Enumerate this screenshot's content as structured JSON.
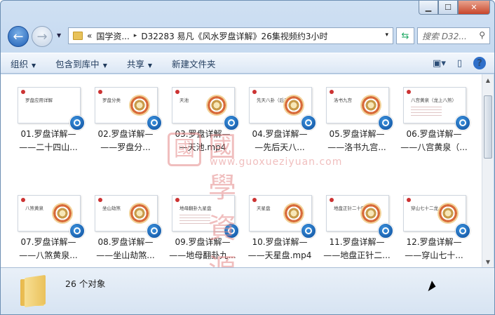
{
  "window_controls": {
    "minimize": "▁",
    "maximize": "☐",
    "close": "✕"
  },
  "address": {
    "history": "«",
    "crumbs": [
      "国学资...",
      "D32283 易凡《风水罗盘详解》26集视频约3小时"
    ],
    "separator": "▸",
    "dropdown": "▾"
  },
  "search": {
    "placeholder": "搜索 D32...",
    "icon": "search-icon"
  },
  "toolbar": {
    "organize": "组织",
    "include_library": "包含到库中",
    "share": "共享",
    "new_folder": "新建文件夹",
    "dropdown_glyph": "▼"
  },
  "items": [
    {
      "line1": "01.罗盘详解—",
      "line2": "——二十四山...",
      "thumb_title": "罗盘应用详解",
      "thumb": "plain"
    },
    {
      "line1": "02.罗盘详解—",
      "line2": "——罗盘分...",
      "thumb_title": "罗盘分类",
      "thumb": "wheel"
    },
    {
      "line1": "03.罗盘详解—",
      "line2": "—天池.mp4",
      "thumb_title": "天池",
      "thumb": "wheel"
    },
    {
      "line1": "04.罗盘详解—",
      "line2": "—先后天八...",
      "thumb_title": "先天八卦（后天）",
      "thumb": "wheel"
    },
    {
      "line1": "05.罗盘详解—",
      "line2": "——洛书九宫...",
      "thumb_title": "洛书九宫",
      "thumb": "wheel"
    },
    {
      "line1": "06.罗盘详解—",
      "line2": "——八宫黄泉（...",
      "thumb_title": "八宫黄泉（龙上八煞）",
      "thumb": "lines"
    },
    {
      "line1": "07.罗盘详解—",
      "line2": "——八煞黄泉...",
      "thumb_title": "八煞黄泉",
      "thumb": "wheel"
    },
    {
      "line1": "08.罗盘详解—",
      "line2": "——坐山劫煞...",
      "thumb_title": "坐山劫煞",
      "thumb": "wheel"
    },
    {
      "line1": "09.罗盘详解—",
      "line2": "——地母翻卦九...",
      "thumb_title": "地母翻卦九星盘",
      "thumb": "lines"
    },
    {
      "line1": "10.罗盘详解—",
      "line2": "——天星盘.mp4",
      "thumb_title": "天星盘",
      "thumb": "wheel"
    },
    {
      "line1": "11.罗盘详解—",
      "line2": "——地盘正针二...",
      "thumb_title": "地盘正针二十四山",
      "thumb": "wheel"
    },
    {
      "line1": "12.罗盘详解—",
      "line2": "——穿山七十...",
      "thumb_title": "穿山七十二龙",
      "thumb": "wheel"
    }
  ],
  "watermark": {
    "seal": "國",
    "text": "國學資源網",
    "url": "www.guoxueziyuan.com"
  },
  "status": {
    "count": "26 个对象"
  },
  "colors": {
    "accent": "#2f6fc9",
    "watermark": "#e48a8a"
  }
}
